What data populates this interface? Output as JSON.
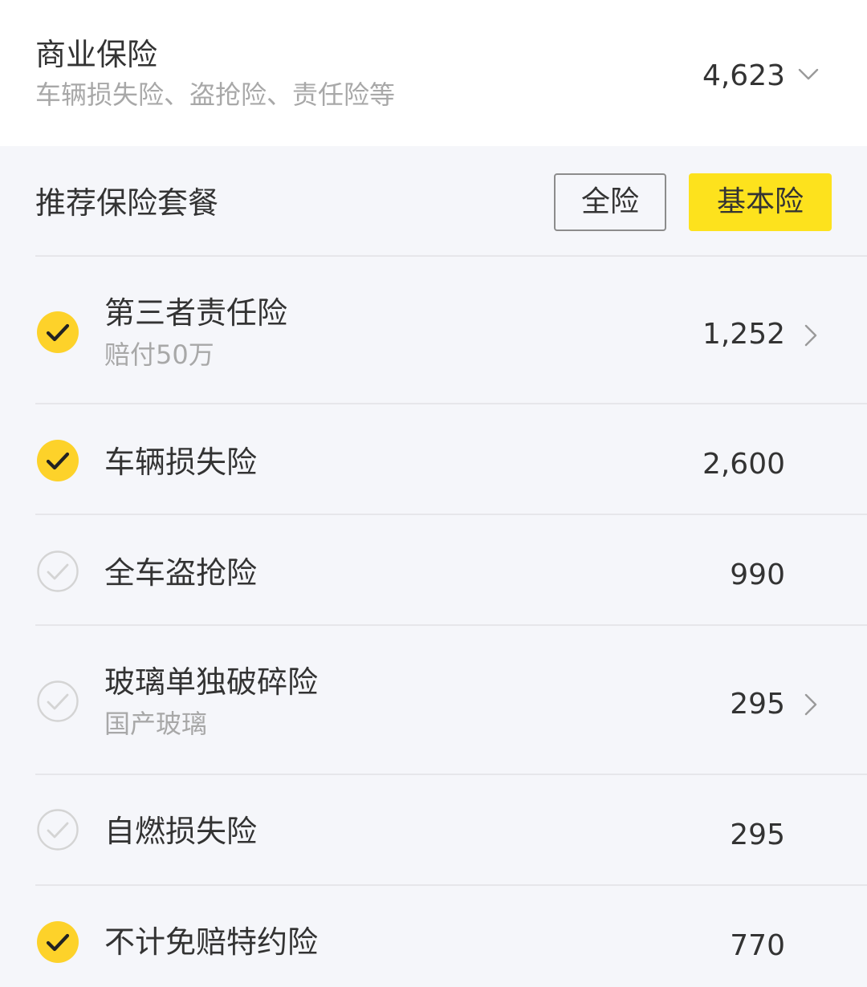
{
  "commercial": {
    "title": "商业保险",
    "subtitle": "车辆损失险、盗抢险、责任险等",
    "total": "4,623",
    "expand_icon": "chevron-down-icon"
  },
  "package": {
    "title": "推荐保险套餐",
    "full_label": "全险",
    "basic_label": "基本险",
    "selected": "基本险"
  },
  "colors": {
    "accent_yellow": "#fde21d",
    "check_yellow": "#fdd22a",
    "background": "#f5f6fa"
  },
  "items": [
    {
      "label": "第三者责任险",
      "sub": "赔付50万",
      "price": "1,252",
      "checked": true,
      "has_arrow": true
    },
    {
      "label": "车辆损失险",
      "sub": "",
      "price": "2,600",
      "checked": true,
      "has_arrow": false
    },
    {
      "label": "全车盗抢险",
      "sub": "",
      "price": "990",
      "checked": false,
      "has_arrow": false
    },
    {
      "label": "玻璃单独破碎险",
      "sub": "国产玻璃",
      "price": "295",
      "checked": false,
      "has_arrow": true
    },
    {
      "label": "自燃损失险",
      "sub": "",
      "price": "295",
      "checked": false,
      "has_arrow": false
    },
    {
      "label": "不计免赔特约险",
      "sub": "",
      "price": "770",
      "checked": true,
      "has_arrow": false
    }
  ]
}
